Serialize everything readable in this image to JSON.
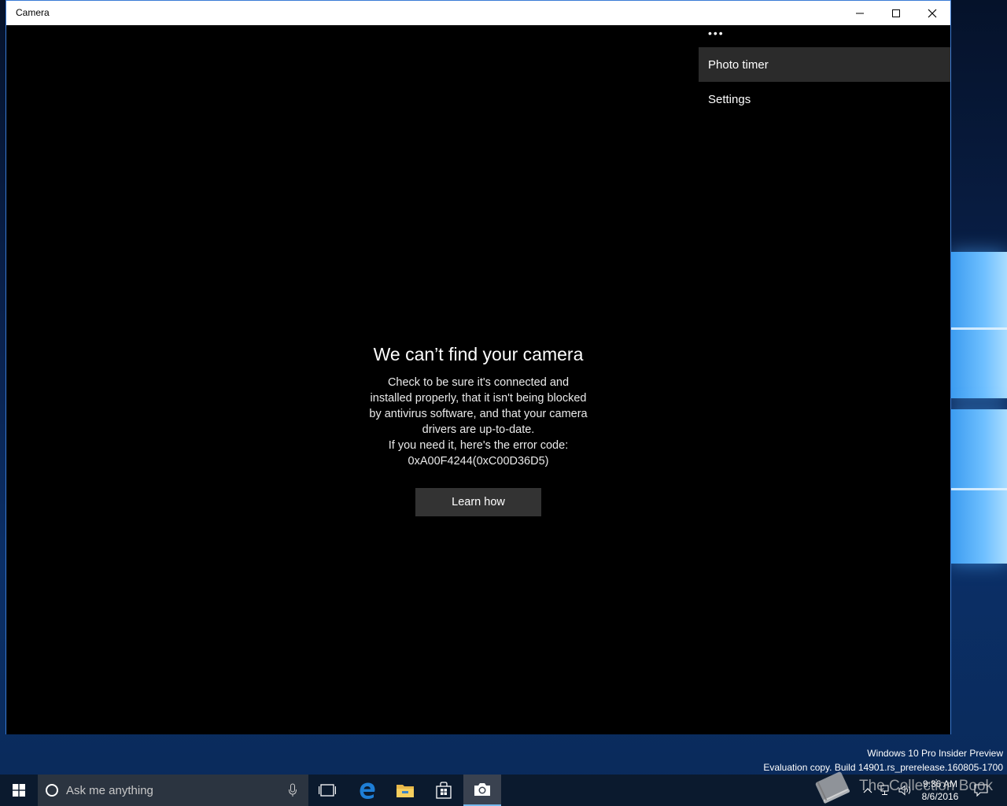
{
  "window": {
    "title": "Camera",
    "controls": [
      "minimize-icon",
      "maximize-icon",
      "close-icon"
    ]
  },
  "menu": {
    "more_label": "•••",
    "items": [
      {
        "label": "Photo timer",
        "highlighted": true
      },
      {
        "label": "Settings",
        "highlighted": false
      }
    ]
  },
  "error": {
    "title": "We can’t find your camera",
    "lines": [
      "Check to be sure it's connected and",
      "installed properly, that it isn't being blocked",
      "by antivirus software, and that your camera",
      "drivers are up-to-date.",
      "If you need it, here's the error code:",
      "0xA00F4244(0xC00D36D5)"
    ],
    "button_label": "Learn how"
  },
  "watermark": {
    "line1": "Windows 10 Pro Insider Preview",
    "line2": "Evaluation copy. Build 14901.rs_prerelease.160805-1700"
  },
  "taskbar": {
    "search_placeholder": "Ask me anything",
    "clock_time": "9:36 AM",
    "clock_date": "8/6/2016",
    "pinned": [
      "task-view-icon",
      "edge-icon",
      "file-explorer-icon",
      "store-icon",
      "camera-icon"
    ],
    "active_app": "camera-icon"
  },
  "overlay_text": "The Collection Book",
  "colors": {
    "accent": "#3a7bd5",
    "taskbar": "#0b1a2e",
    "button": "#333333",
    "menu_highlight": "#2b2b2b"
  }
}
